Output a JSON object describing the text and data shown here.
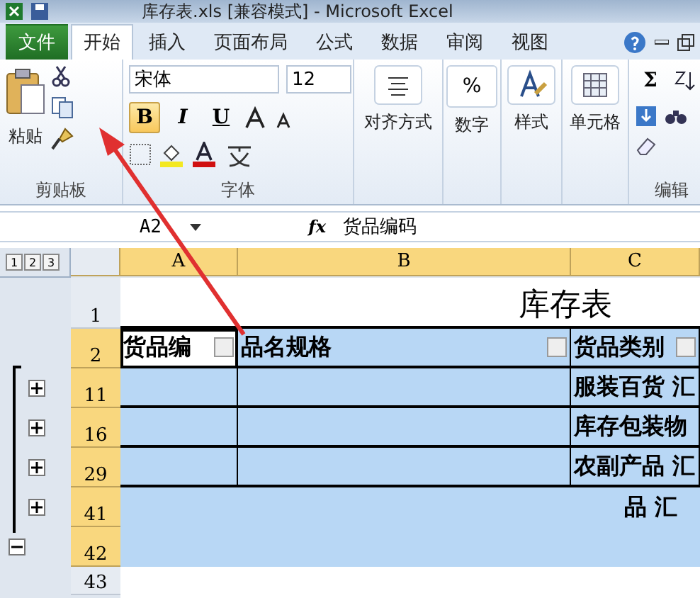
{
  "window": {
    "title": "库存表.xls [兼容模式] - Microsoft Excel"
  },
  "tabs": [
    {
      "label": "文件",
      "kind": "file",
      "selected": false
    },
    {
      "label": "开始",
      "kind": "tab",
      "selected": true
    },
    {
      "label": "插入",
      "kind": "tab",
      "selected": false
    },
    {
      "label": "页面布局",
      "kind": "tab",
      "selected": false
    },
    {
      "label": "公式",
      "kind": "tab",
      "selected": false
    },
    {
      "label": "数据",
      "kind": "tab",
      "selected": false
    },
    {
      "label": "审阅",
      "kind": "tab",
      "selected": false
    },
    {
      "label": "视图",
      "kind": "tab",
      "selected": false
    }
  ],
  "clipboard": {
    "label": "剪贴板",
    "paste": "粘贴"
  },
  "font": {
    "label": "字体",
    "name": "宋体",
    "size": "12",
    "bold_button": "B",
    "italic_button": "I",
    "underline_button": "U",
    "bold": true
  },
  "groups": [
    {
      "label": "对齐方式",
      "kind": "align"
    },
    {
      "label": "数字",
      "kind": "number",
      "symbol": "%"
    },
    {
      "label": "样式",
      "kind": "style"
    },
    {
      "label": "单元格",
      "kind": "cells"
    }
  ],
  "editing": {
    "label": "编辑",
    "sum": "Σ"
  },
  "formula_bar": {
    "name_box": "A2",
    "fx": "fx",
    "value": "货品编码"
  },
  "outline_levels": [
    "1",
    "2",
    "3"
  ],
  "columns": [
    {
      "label": "A",
      "selected": true
    },
    {
      "label": "B",
      "selected": true
    },
    {
      "label": "C",
      "selected": true
    }
  ],
  "rows": [
    {
      "header": "1",
      "kind": "title",
      "selected": false,
      "cells": [
        "库存表"
      ]
    },
    {
      "header": "2",
      "kind": "header",
      "selected": true,
      "cells": [
        "货品编",
        "品名规格",
        "货品类别"
      ]
    },
    {
      "header": "11",
      "kind": "group",
      "selected": true,
      "collapsed": true,
      "cells": [
        "",
        "",
        "服装百货 汇"
      ]
    },
    {
      "header": "16",
      "kind": "group",
      "selected": true,
      "collapsed": true,
      "cells": [
        "",
        "",
        "库存包装物"
      ]
    },
    {
      "header": "29",
      "kind": "group",
      "selected": true,
      "collapsed": true,
      "cells": [
        "",
        "",
        "农副产品 汇"
      ]
    },
    {
      "header": "41",
      "kind": "merged",
      "selected": true,
      "collapsed": true,
      "cells": [
        "品 汇"
      ]
    },
    {
      "header": "42",
      "kind": "merged",
      "selected": true,
      "collapsed": false,
      "cells": [
        ""
      ]
    },
    {
      "header": "43",
      "kind": "empty",
      "selected": false,
      "cells": []
    }
  ]
}
